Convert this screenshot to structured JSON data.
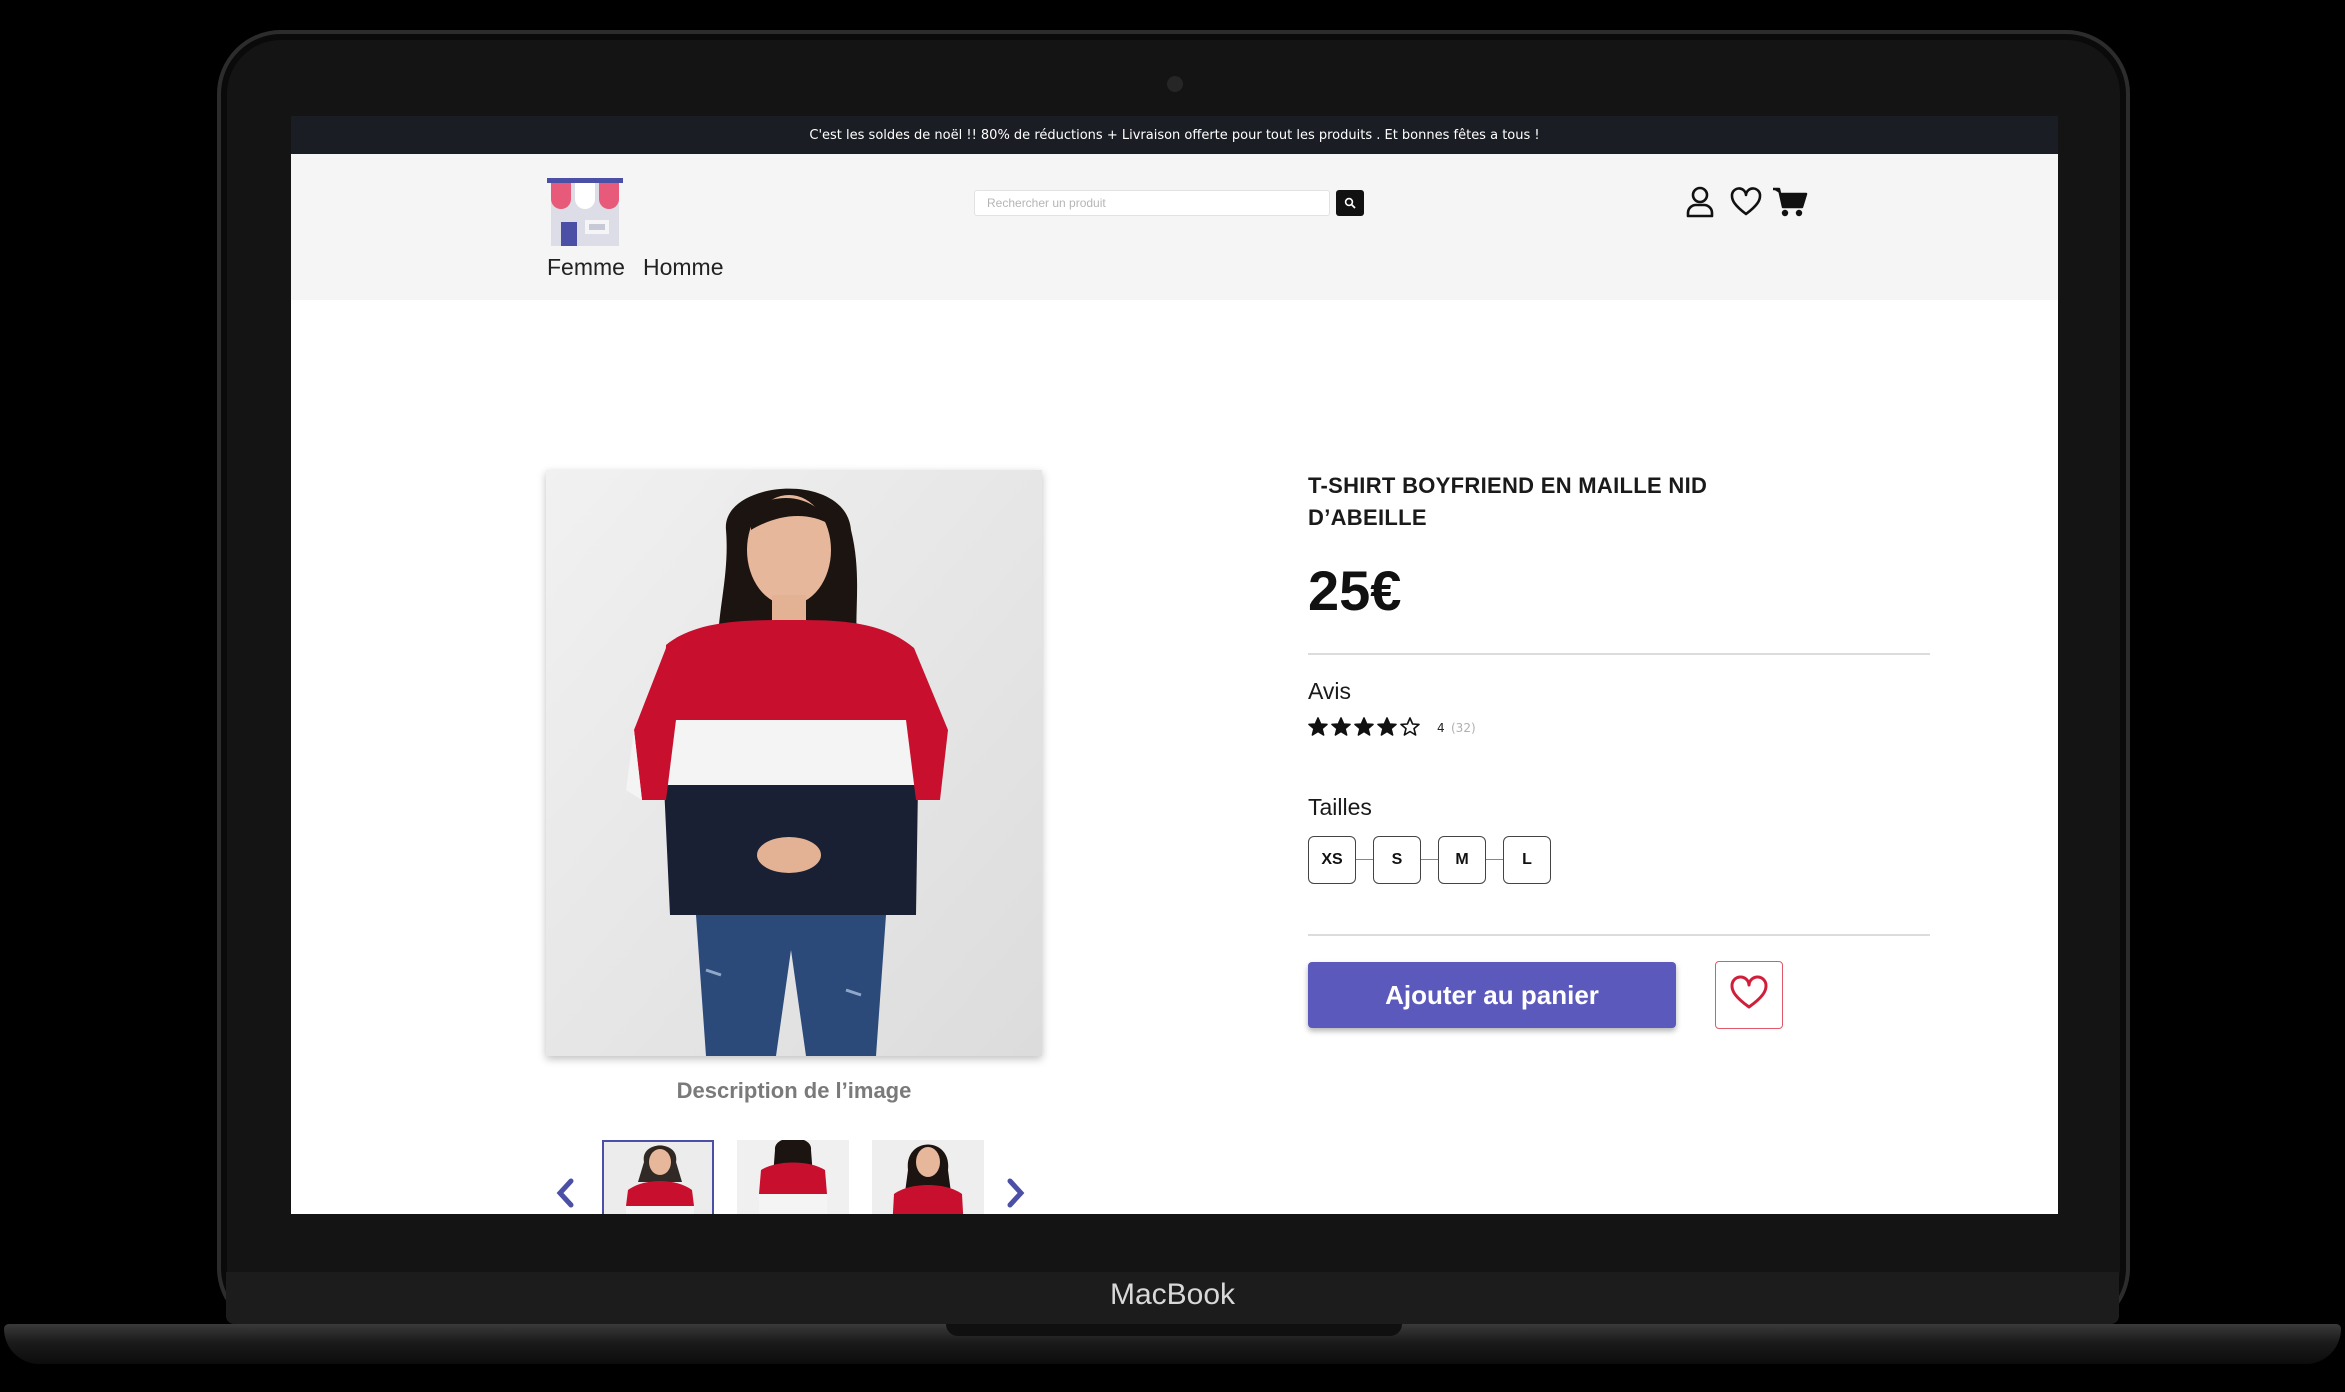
{
  "device": {
    "brand_label": "MacBook"
  },
  "promo": {
    "text": "C'est les soldes de noël !! 80% de réductions + Livraison offerte pour tout les produits . Et bonnes fêtes a tous !"
  },
  "header": {
    "logo_icon": "shop-storefront-icon",
    "nav": [
      {
        "label": "Femme"
      },
      {
        "label": "Homme"
      }
    ],
    "search": {
      "placeholder": "Rechercher un produit",
      "value": "",
      "icon": "search-icon"
    },
    "icons": [
      "user-icon",
      "heart-icon",
      "cart-icon"
    ]
  },
  "product": {
    "title_line1": "T-SHIRT BOYFRIEND EN MAILLE NID",
    "title_line2": "D’ABEILLE",
    "price": "25€",
    "image_caption": "Description de l’image",
    "reviews": {
      "label": "Avis",
      "rating": 4,
      "max": 5,
      "rating_text": "4",
      "count_text": "(32)"
    },
    "sizes": {
      "label": "Tailles",
      "options": [
        "XS",
        "S",
        "M",
        "L"
      ]
    },
    "add_to_cart_label": "Ajouter au panier",
    "thumbnails": {
      "count": 3,
      "active_index": 0
    }
  },
  "colors": {
    "promo_bg": "#1a1d24",
    "header_bg": "#f5f5f5",
    "accent": "#5b59bc",
    "wishlist": "#e0586a",
    "sweater_red": "#c8102e",
    "sweater_navy": "#1a2033"
  }
}
